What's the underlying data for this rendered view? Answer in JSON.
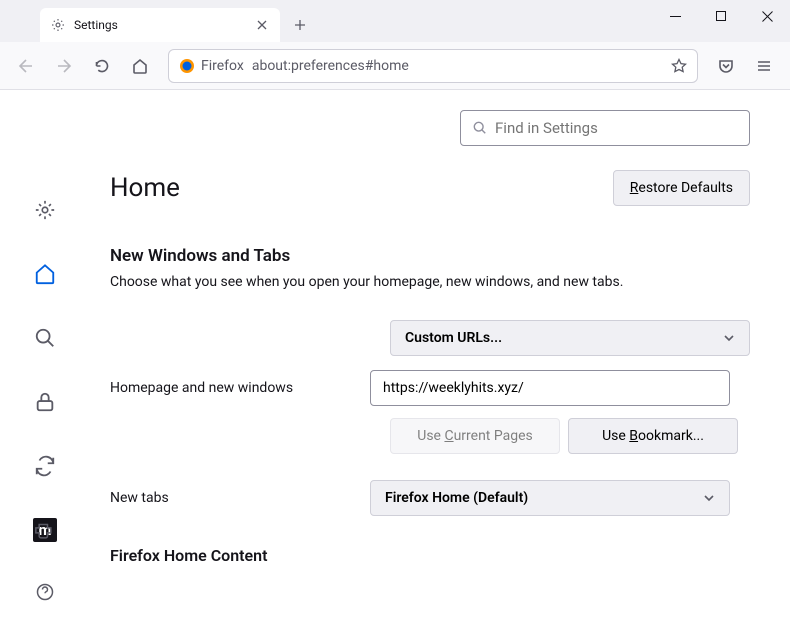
{
  "tab": {
    "title": "Settings"
  },
  "urlbar": {
    "label": "Firefox",
    "url": "about:preferences#home"
  },
  "search": {
    "placeholder": "Find in Settings"
  },
  "page": {
    "title": "Home",
    "restore_label": "Restore Defaults"
  },
  "section1": {
    "title": "New Windows and Tabs",
    "desc": "Choose what you see when you open your homepage, new windows, and new tabs."
  },
  "homepage": {
    "label": "Homepage and new windows",
    "select": "Custom URLs...",
    "url": "https://weeklyhits.xyz/",
    "current_btn": "Use Current Pages",
    "bookmark_btn": "Use Bookmark..."
  },
  "newtabs": {
    "label": "New tabs",
    "select": "Firefox Home (Default)"
  },
  "section2": {
    "title": "Firefox Home Content"
  }
}
